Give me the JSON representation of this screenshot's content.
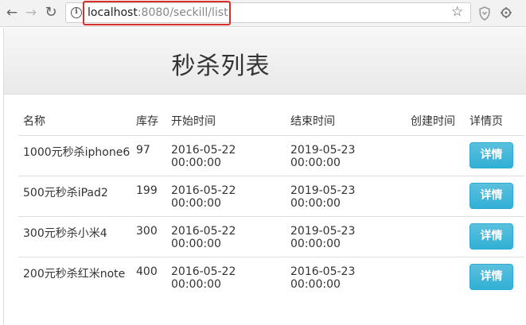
{
  "browser": {
    "url_host": "localhost",
    "url_rest": ":8080/seckill/list",
    "back_icon": "←",
    "forward_icon": "→",
    "reload_icon": "↻",
    "info_icon": "i",
    "star_icon": "☆",
    "highlight_color": "#d9302b"
  },
  "page": {
    "title": "秒杀列表"
  },
  "table": {
    "headers": {
      "name": "名称",
      "stock": "库存",
      "start": "开始时间",
      "end": "结束时间",
      "create": "创建时间",
      "detail": "详情页"
    },
    "rows": [
      {
        "name": "1000元秒杀iphone6",
        "stock": "97",
        "start": "2016-05-22 00:00:00",
        "end": "2019-05-23 00:00:00",
        "create": "",
        "button": "详情"
      },
      {
        "name": "500元秒杀iPad2",
        "stock": "199",
        "start": "2016-05-22 00:00:00",
        "end": "2019-05-23 00:00:00",
        "create": "",
        "button": "详情"
      },
      {
        "name": "300元秒杀小米4",
        "stock": "300",
        "start": "2016-05-22 00:00:00",
        "end": "2019-05-23 00:00:00",
        "create": "",
        "button": "详情"
      },
      {
        "name": "200元秒杀红米note",
        "stock": "400",
        "start": "2016-05-22 00:00:00",
        "end": "2016-05-23 00:00:00",
        "create": "",
        "button": "详情"
      }
    ],
    "button_color": "#5bc0de"
  }
}
